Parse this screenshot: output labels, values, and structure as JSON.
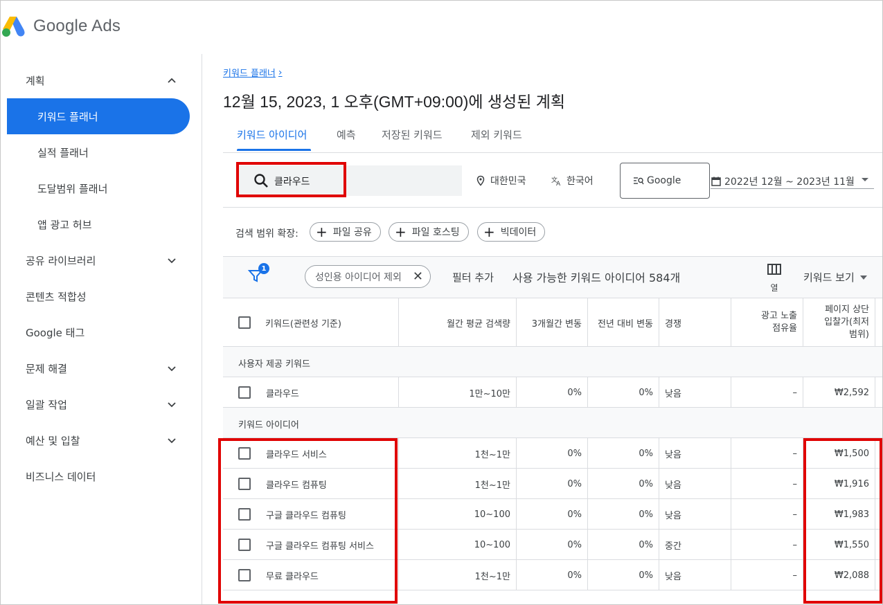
{
  "app": {
    "logo_text": "Google Ads"
  },
  "sidebar": {
    "items": [
      {
        "label": "계획",
        "chevron": "up"
      },
      {
        "label": "키워드 플래너",
        "active": true
      },
      {
        "label": "실적 플래너"
      },
      {
        "label": "도달범위 플래너"
      },
      {
        "label": "앱 광고 허브"
      },
      {
        "label": "공유 라이브러리",
        "chevron": "down"
      },
      {
        "label": "콘텐츠 적합성"
      },
      {
        "label": "Google 태그"
      },
      {
        "label": "문제 해결",
        "chevron": "down"
      },
      {
        "label": "일괄 작업",
        "chevron": "down"
      },
      {
        "label": "예산 및 입찰",
        "chevron": "down"
      },
      {
        "label": "비즈니스 데이터"
      }
    ]
  },
  "breadcrumb": {
    "label": "키워드 플래너"
  },
  "page_title": "12월 15, 2023, 1 오후(GMT+09:00)에 생성된 계획",
  "tabs": [
    {
      "label": "키워드 아이디어",
      "active": true
    },
    {
      "label": "예측"
    },
    {
      "label": "저장된 키워드"
    },
    {
      "label": "제외 키워드"
    }
  ],
  "search": {
    "value": "클라우드",
    "location": "대한민국",
    "language": "한국어",
    "network": "Google",
    "date_range": "2022년 12월 ~ 2023년 11월"
  },
  "expand": {
    "label": "검색 범위 확장:",
    "pills": [
      "파일 공유",
      "파일 호스팅",
      "빅데이터"
    ]
  },
  "filter_bar": {
    "badge": "1",
    "chip": "성인용 아이디어 제외",
    "add_filter": "필터 추가",
    "available": "사용 가능한 키워드 아이디어 584개",
    "columns_label": "열",
    "view_label": "키워드 보기"
  },
  "table": {
    "headers": {
      "keyword": "키워드(관련성 기준)",
      "monthly": "월간 평균 검색량",
      "three_month": "3개월간 변동",
      "yoy": "전년 대비 변동",
      "competition": "경쟁",
      "impression_share_1": "광고 노출",
      "impression_share_2": "점유율",
      "bid_1": "페이지 상단",
      "bid_2": "입찰가(최저",
      "bid_3": "범위)"
    },
    "section_user": "사용자 제공 키워드",
    "user_rows": [
      {
        "keyword": "클라우드",
        "monthly": "1만~10만",
        "three_month": "0%",
        "yoy": "0%",
        "competition": "낮음",
        "share": "–",
        "bid": "₩2,592"
      }
    ],
    "section_ideas": "키워드 아이디어",
    "idea_rows": [
      {
        "keyword": "클라우드 서비스",
        "monthly": "1천~1만",
        "three_month": "0%",
        "yoy": "0%",
        "competition": "낮음",
        "share": "–",
        "bid": "₩1,500"
      },
      {
        "keyword": "클라우드 컴퓨팅",
        "monthly": "1천~1만",
        "three_month": "0%",
        "yoy": "0%",
        "competition": "낮음",
        "share": "–",
        "bid": "₩1,916"
      },
      {
        "keyword": "구글 클라우드 컴퓨팅",
        "monthly": "10~100",
        "three_month": "0%",
        "yoy": "0%",
        "competition": "낮음",
        "share": "–",
        "bid": "₩1,983"
      },
      {
        "keyword": "구글 클라우드 컴퓨팅 서비스",
        "monthly": "10~100",
        "three_month": "0%",
        "yoy": "0%",
        "competition": "중간",
        "share": "–",
        "bid": "₩1,550"
      },
      {
        "keyword": "무료 클라우드",
        "monthly": "1천~1만",
        "three_month": "0%",
        "yoy": "0%",
        "competition": "낮음",
        "share": "–",
        "bid": "₩2,088"
      }
    ]
  },
  "colors": {
    "accent": "#1a73e8",
    "highlight": "#e00000"
  }
}
